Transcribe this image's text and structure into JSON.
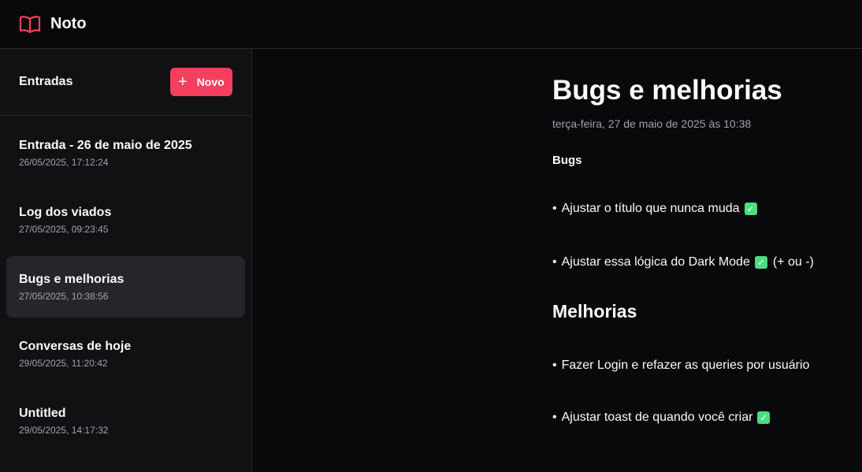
{
  "app": {
    "title": "Noto"
  },
  "sidebar": {
    "title": "Entradas",
    "new_button_label": "Novo",
    "entries": [
      {
        "title": "Entrada - 26 de maio de 2025",
        "date": "26/05/2025, 17:12:24",
        "active": false
      },
      {
        "title": "Log dos viados",
        "date": "27/05/2025, 09:23:45",
        "active": false
      },
      {
        "title": "Bugs e melhorias",
        "date": "27/05/2025, 10:38:56",
        "active": true
      },
      {
        "title": "Conversas de hoje",
        "date": "29/05/2025, 11:20:42",
        "active": false
      },
      {
        "title": "Untitled",
        "date": "29/05/2025, 14:17:32",
        "active": false
      }
    ]
  },
  "document": {
    "title": "Bugs e melhorias",
    "date": "terça-feira, 27 de maio de 2025 às 10:38",
    "section1_heading": "Bugs",
    "items1": [
      {
        "text": "Ajustar o título que nunca muda",
        "check": true,
        "suffix": ""
      },
      {
        "text": "Ajustar essa lógica do Dark Mode",
        "check": true,
        "suffix": "(+ ou -)"
      }
    ],
    "section2_heading": "Melhorias",
    "items2": [
      {
        "text": "Fazer Login e refazer as queries por usuário",
        "check": false,
        "suffix": ""
      },
      {
        "text": "Ajustar toast de quando você criar",
        "check": true,
        "suffix": ""
      }
    ]
  },
  "colors": {
    "accent": "#f43f5e",
    "check": "#4ade80",
    "background": "#09090b",
    "sidebar": "#111113"
  },
  "icons": {
    "logo": "book-open-icon",
    "new": "plus-icon",
    "check": "check-box-icon"
  }
}
